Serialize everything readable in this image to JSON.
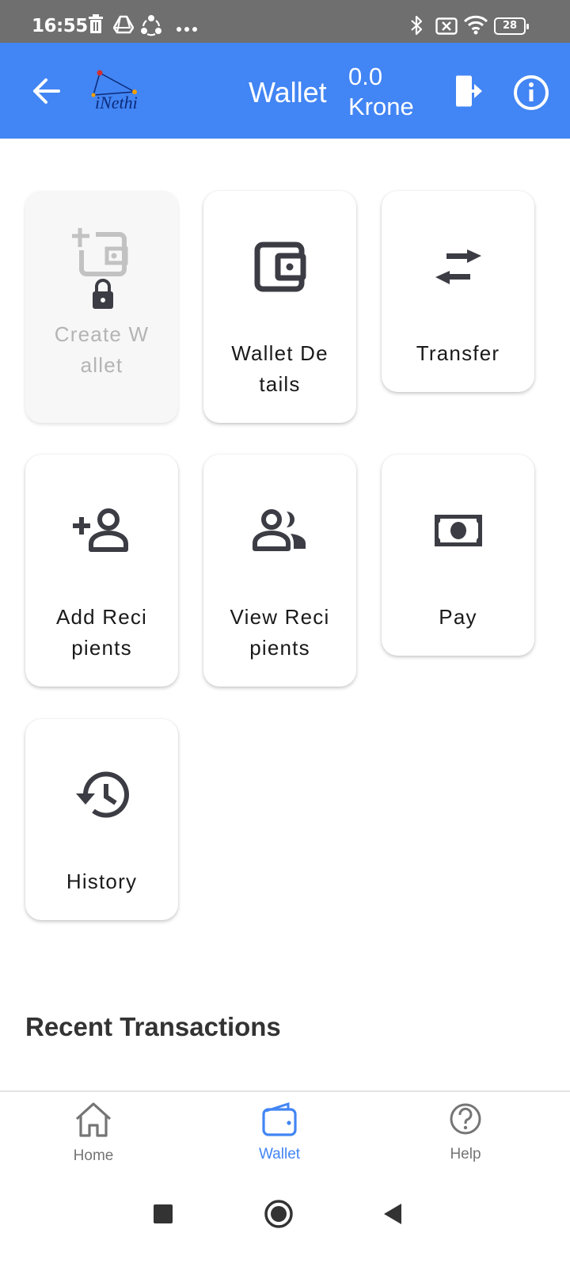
{
  "status_bar": {
    "time": "16:55",
    "battery": "28",
    "left_icons": [
      "trash-icon",
      "drive-icon",
      "share-icon",
      "more-dots-icon"
    ],
    "right_icons": [
      "bluetooth-icon",
      "no-sim-icon",
      "wifi-icon",
      "battery-icon"
    ]
  },
  "app_bar": {
    "logo_text": "iNethi",
    "title": "Wallet",
    "balance_amount": "0.0",
    "balance_currency": "Krone",
    "color": "#4285f4"
  },
  "tiles": [
    {
      "label": "Create Wallet",
      "icon": "add-wallet-icon",
      "disabled": true
    },
    {
      "label": "Wallet Details",
      "icon": "wallet-icon",
      "disabled": false
    },
    {
      "label": "Transfer",
      "icon": "transfer-arrows-icon",
      "disabled": false
    },
    {
      "label": "Add Recipients",
      "icon": "add-person-icon",
      "disabled": false
    },
    {
      "label": "View Recipients",
      "icon": "people-icon",
      "disabled": false
    },
    {
      "label": "Pay",
      "icon": "money-icon",
      "disabled": false
    },
    {
      "label": "History",
      "icon": "history-icon",
      "disabled": false
    }
  ],
  "recent": {
    "title": "Recent Transactions"
  },
  "bottom_nav": {
    "items": [
      {
        "label": "Home",
        "icon": "home-icon",
        "active": false
      },
      {
        "label": "Wallet",
        "icon": "wallet-icon",
        "active": true
      },
      {
        "label": "Help",
        "icon": "help-icon",
        "active": false
      }
    ],
    "active_color": "#4285f4"
  }
}
